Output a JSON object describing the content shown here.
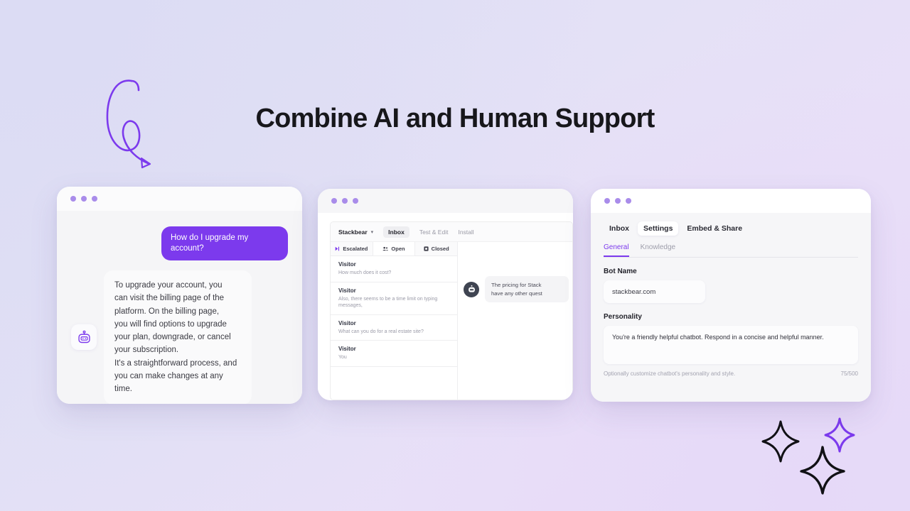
{
  "headline": "Combine AI and Human Support",
  "decor": {
    "squiggle_icon": "curly-arrow-doodle",
    "sparkle_icons": [
      "sparkle-star-outline",
      "sparkle-star-outline-purple",
      "sparkle-star-outline"
    ],
    "accent_purple": "#7C3AED",
    "dot_purple": "#A98CEA"
  },
  "chat_card": {
    "window_dots_icon": "window-dots",
    "user_message": "How do I upgrade my account?",
    "bot_avatar_icon": "robot-icon",
    "bot_message_lines": [
      "To upgrade your account, you",
      "can visit the billing page of the",
      "platform. On the billing page,",
      "you will find options to upgrade",
      "your plan, downgrade, or cancel",
      "your subscription.",
      "It's a straightforward process, and",
      "you can make changes at any time."
    ]
  },
  "inbox_card": {
    "window_dots_icon": "window-dots",
    "brand": "Stackbear",
    "brand_caret_icon": "chevron-down-icon",
    "nav": [
      {
        "label": "Inbox",
        "active": true
      },
      {
        "label": "Test & Edit",
        "active": false
      },
      {
        "label": "Install",
        "active": false
      }
    ],
    "segments": [
      {
        "label": "Escalated",
        "icon": "escalate-arrow-icon",
        "active": false
      },
      {
        "label": "Open",
        "icon": "people-icon",
        "active": true
      },
      {
        "label": "Closed",
        "icon": "archive-box-icon",
        "active": false
      }
    ],
    "conversations": [
      {
        "name": "Visitor",
        "snippet": "How much does it cost?"
      },
      {
        "name": "Visitor",
        "snippet": "Also, there seems to be a time limit on typing messages,"
      },
      {
        "name": "Visitor",
        "snippet": "What can you do for a real estate site?"
      },
      {
        "name": "Visitor",
        "snippet": "You"
      }
    ],
    "agent_avatar_icon": "robot-icon",
    "agent_message_lines": [
      "The pricing for Stack",
      "have any other quest"
    ]
  },
  "settings_card": {
    "window_dots_icon": "window-dots",
    "tabs_main": [
      {
        "label": "Inbox",
        "active": false
      },
      {
        "label": "Settings",
        "active": true
      },
      {
        "label": "Embed & Share",
        "active": false
      }
    ],
    "tabs_sub": [
      {
        "label": "General",
        "active": true
      },
      {
        "label": "Knowledge",
        "active": false
      }
    ],
    "bot_name_label": "Bot Name",
    "bot_name_value": "stackbear.com",
    "personality_label": "Personality",
    "personality_value": "You're a friendly helpful chatbot. Respond in a concise and helpful manner.",
    "helper_text": "Optionally customize chatbot's personality and style.",
    "char_counter": "75/500"
  }
}
